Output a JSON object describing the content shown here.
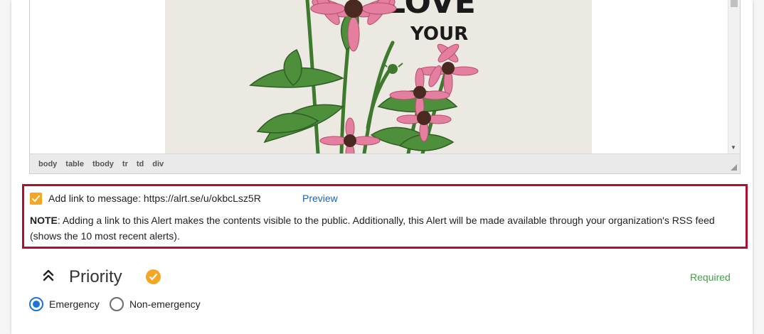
{
  "editor": {
    "image_text": "LOVE\nYOUR",
    "status_path": [
      "body",
      "table",
      "tbody",
      "tr",
      "td",
      "div"
    ]
  },
  "link_section": {
    "checkbox_checked": true,
    "label": "Add link to message: https://alrt.se/u/okbcLsz5R",
    "preview_label": "Preview",
    "note_prefix": "NOTE",
    "note_text": ": Adding a link to this Alert makes the contents visible to the public. Additionally, this Alert will be made available through your organization's RSS feed (shows the 10 most recent alerts).",
    "highlight_color": "#b00f2e"
  },
  "priority": {
    "title": "Priority",
    "required_label": "Required",
    "options": [
      {
        "label": "Emergency",
        "selected": true
      },
      {
        "label": "Non-emergency",
        "selected": false
      }
    ],
    "accent_color": "#f5a623",
    "radio_color": "#1976d2"
  }
}
